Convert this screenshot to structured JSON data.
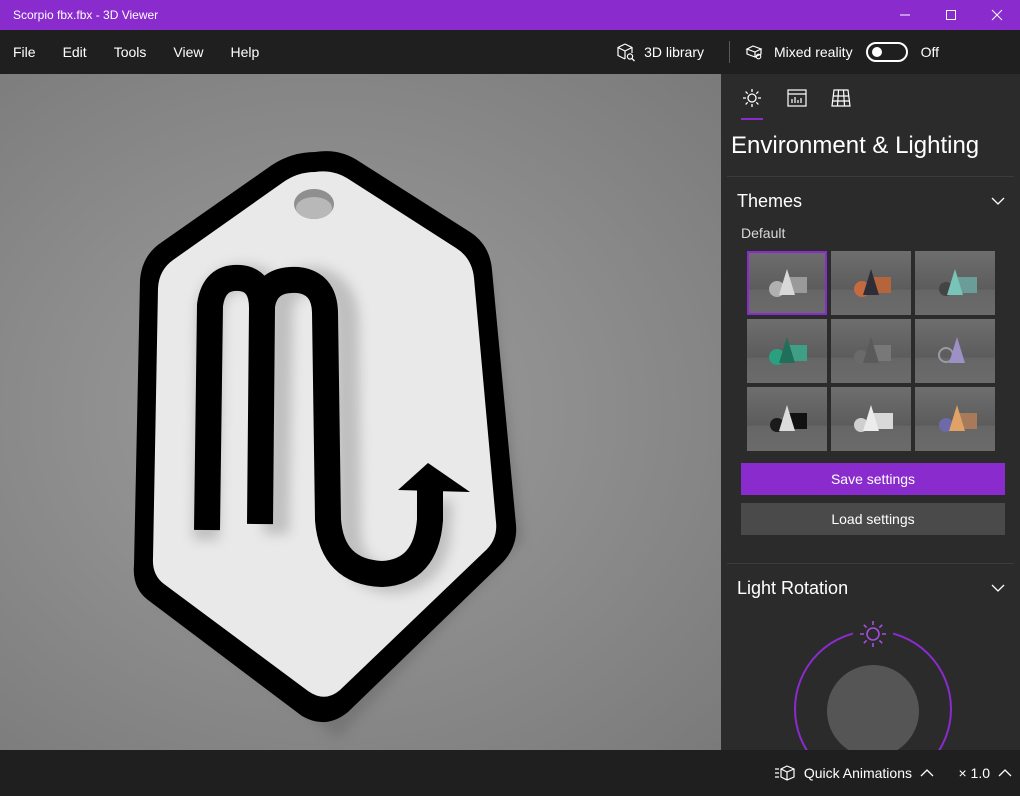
{
  "window": {
    "title": "Scorpio fbx.fbx - 3D Viewer",
    "titlebar_color": "#8a2bce",
    "controls": [
      "minimize-icon",
      "maximize-icon",
      "close-icon"
    ]
  },
  "menu": {
    "items": [
      "File",
      "Edit",
      "Tools",
      "View",
      "Help"
    ],
    "library_label": "3D library",
    "mixed_reality_label": "Mixed reality",
    "mixed_reality_state": "Off",
    "mixed_reality_on": false
  },
  "panel": {
    "tabs": [
      {
        "icon": "environment-lighting-icon",
        "active": true
      },
      {
        "icon": "stats-shading-icon",
        "active": false
      },
      {
        "icon": "grid-views-icon",
        "active": false
      }
    ],
    "title": "Environment & Lighting",
    "themes": {
      "title": "Themes",
      "selected_label": "Default",
      "count": 9,
      "selected_index": 0
    },
    "save_label": "Save settings",
    "load_label": "Load settings",
    "light_rotation": {
      "title": "Light Rotation"
    }
  },
  "status": {
    "quick_animations_label": "Quick Animations",
    "speed_label": "× 1.0"
  },
  "colors": {
    "accent": "#8a2bce",
    "panel_bg": "#2b2b2b",
    "app_bg": "#1f1f1f"
  }
}
